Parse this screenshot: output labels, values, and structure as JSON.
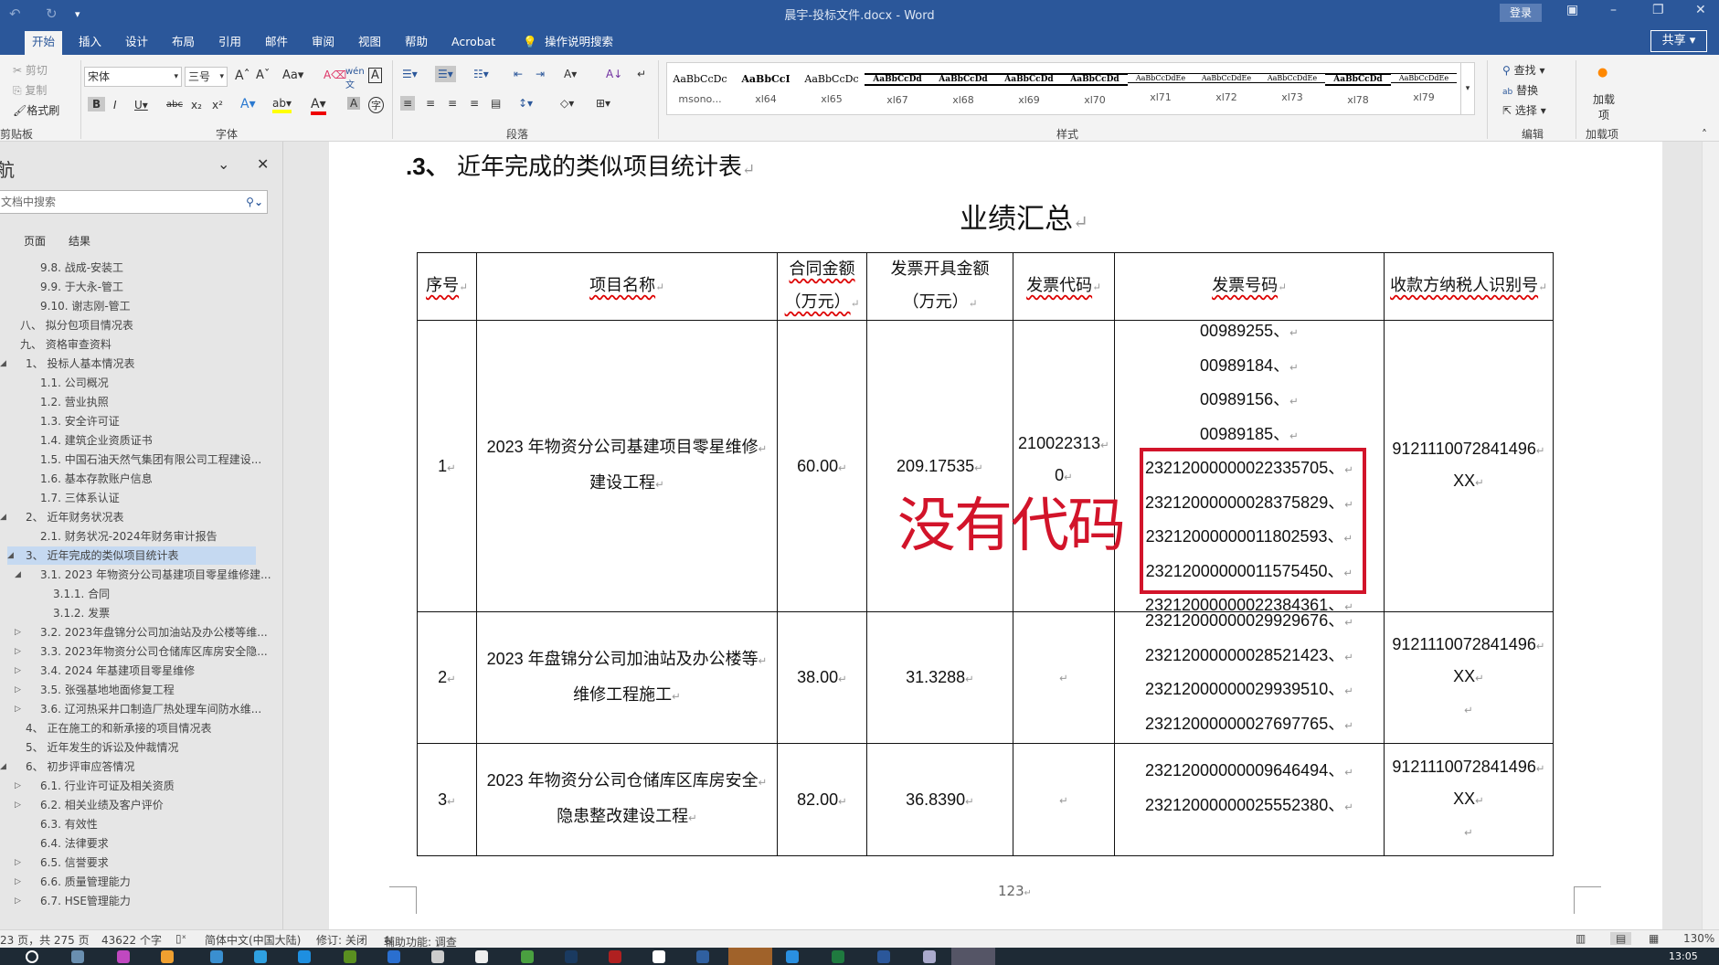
{
  "window": {
    "title": "晨宇-投标文件.docx - Word",
    "login": "登录",
    "share": "共享"
  },
  "tabs": [
    "开始",
    "插入",
    "设计",
    "布局",
    "引用",
    "邮件",
    "审阅",
    "视图",
    "帮助",
    "Acrobat",
    "操作说明搜索"
  ],
  "ribbon": {
    "clipboard": {
      "cut": "剪切",
      "copy": "复制",
      "format_painter": "格式刷",
      "label": "剪贴板"
    },
    "font": {
      "name": "宋体",
      "size": "三号",
      "label": "字体"
    },
    "paragraph": {
      "label": "段落"
    },
    "styles": {
      "label": "样式",
      "items": [
        "msono...",
        "xl64",
        "xl65",
        "xl67",
        "xl68",
        "xl69",
        "xl70",
        "xl71",
        "xl72",
        "xl73",
        "xl78",
        "xl79"
      ],
      "preview": [
        "AaBbCcDc",
        "AaBbCcI",
        "AaBbCcDc",
        "AaBbCcDd",
        "AaBbCcDd",
        "AaBbCcDd",
        "AaBbCcDd",
        "AaBbCcDdEe",
        "AaBbCcDdEe",
        "AaBbCcDdEe",
        "AaBbCcDd",
        "AaBbCcDdEe"
      ]
    },
    "editing": {
      "find": "查找",
      "replace": "替换",
      "select": "选择",
      "label": "编辑"
    },
    "addins": {
      "button": "加载项",
      "label": "加载项"
    }
  },
  "nav": {
    "title": "航",
    "search_placeholder": "文档中搜索",
    "tabs": [
      "页面",
      "结果"
    ],
    "items": [
      {
        "label": "9.8. 战成-安装工",
        "level": 2,
        "toggle": ""
      },
      {
        "label": "9.9. 于大永-管工",
        "level": 2,
        "toggle": ""
      },
      {
        "label": "9.10. 谢志刚-管工",
        "level": 2,
        "toggle": ""
      },
      {
        "label": "八、 拟分包项目情况表",
        "level": 0,
        "toggle": ""
      },
      {
        "label": "九、 资格审查资料",
        "level": 0,
        "toggle": ""
      },
      {
        "label": "1、 投标人基本情况表",
        "level": 1,
        "toggle": "◢"
      },
      {
        "label": "1.1. 公司概况",
        "level": 2,
        "toggle": ""
      },
      {
        "label": "1.2. 营业执照",
        "level": 2,
        "toggle": ""
      },
      {
        "label": "1.3. 安全许可证",
        "level": 2,
        "toggle": ""
      },
      {
        "label": "1.4. 建筑企业资质证书",
        "level": 2,
        "toggle": ""
      },
      {
        "label": "1.5. 中国石油天然气集团有限公司工程建设...",
        "level": 2,
        "toggle": ""
      },
      {
        "label": "1.6. 基本存款账户信息",
        "level": 2,
        "toggle": ""
      },
      {
        "label": "1.7. 三体系认证",
        "level": 2,
        "toggle": ""
      },
      {
        "label": "2、 近年财务状况表",
        "level": 1,
        "toggle": "◢"
      },
      {
        "label": "2.1. 财务状况-2024年财务审计报告",
        "level": 2,
        "toggle": ""
      },
      {
        "label": "3、 近年完成的类似项目统计表",
        "level": 1,
        "toggle": "◢",
        "selected": true
      },
      {
        "label": "3.1. 2023 年物资分公司基建项目零星维修建...",
        "level": 2,
        "toggle": "◢"
      },
      {
        "label": "3.1.1. 合同",
        "level": 3,
        "toggle": ""
      },
      {
        "label": "3.1.2. 发票",
        "level": 3,
        "toggle": ""
      },
      {
        "label": "3.2. 2023年盘锦分公司加油站及办公楼等维...",
        "level": 2,
        "toggle": "▷"
      },
      {
        "label": "3.3. 2023年物资分公司仓储库区库房安全隐...",
        "level": 2,
        "toggle": "▷"
      },
      {
        "label": "3.4. 2024 年基建项目零星维修",
        "level": 2,
        "toggle": "▷"
      },
      {
        "label": "3.5. 张强基地地面修复工程",
        "level": 2,
        "toggle": "▷"
      },
      {
        "label": "3.6. 辽河热采井口制造厂热处理车间防水维...",
        "level": 2,
        "toggle": "▷"
      },
      {
        "label": "4、 正在施工的和新承接的项目情况表",
        "level": 1,
        "toggle": ""
      },
      {
        "label": "5、 近年发生的诉讼及仲裁情况",
        "level": 1,
        "toggle": ""
      },
      {
        "label": "6、 初步评审应答情况",
        "level": 1,
        "toggle": "◢"
      },
      {
        "label": "6.1. 行业许可证及相关资质",
        "level": 2,
        "toggle": "▷"
      },
      {
        "label": "6.2. 相关业绩及客户评价",
        "level": 2,
        "toggle": "▷"
      },
      {
        "label": "6.3. 有效性",
        "level": 2,
        "toggle": ""
      },
      {
        "label": "6.4. 法律要求",
        "level": 2,
        "toggle": ""
      },
      {
        "label": "6.5. 信誉要求",
        "level": 2,
        "toggle": "▷"
      },
      {
        "label": "6.6. 质量管理能力",
        "level": 2,
        "toggle": "▷"
      },
      {
        "label": "6.7. HSE管理能力",
        "level": 2,
        "toggle": "▷"
      }
    ]
  },
  "document": {
    "heading_num": ".3、",
    "heading": "近年完成的类似项目统计表",
    "subtitle": "业绩汇总",
    "table": {
      "headers": [
        "序号",
        "项目名称",
        "合同金额",
        "（万元）",
        "发票开具金额",
        "（万元）",
        "发票代码",
        "发票号码",
        "收款方纳税人识别号"
      ],
      "rows": [
        {
          "no": "1",
          "name": [
            "2023 年物资分公司基建项目零星维修",
            "建设工程"
          ],
          "contract": "60.00",
          "invoiced": "209.17535",
          "code": [
            "210022313",
            "0"
          ],
          "numbers": [
            "00989255、",
            "00989184、",
            "00989156、",
            "00989185、",
            "23212000000022335705、",
            "23212000000028375829、",
            "23212000000011802593、",
            "23212000000011575450、",
            "23212000000022384361、"
          ],
          "taxid": [
            "9121110072841496",
            "XX"
          ]
        },
        {
          "no": "2",
          "name": [
            "2023 年盘锦分公司加油站及办公楼等",
            "维修工程施工"
          ],
          "contract": "38.00",
          "invoiced": "31.3288",
          "code": [
            ""
          ],
          "numbers": [
            "23212000000029929676、",
            "23212000000028521423、",
            "23212000000029939510、",
            "23212000000027697765、"
          ],
          "taxid": [
            "9121110072841496",
            "XX"
          ]
        },
        {
          "no": "3",
          "name": [
            "2023 年物资分公司仓储库区库房安全",
            "隐患整改建设工程"
          ],
          "contract": "82.00",
          "invoiced": "36.8390",
          "code": [
            ""
          ],
          "numbers": [
            "23212000000009646494、",
            "23212000000025552380、"
          ],
          "taxid": [
            "9121110072841496",
            "XX"
          ]
        }
      ]
    },
    "annotation": "没有代码",
    "annotation_color": "#d2142a",
    "page_number": "123"
  },
  "status": {
    "page": "23 页，共 275 页",
    "words": "43622 个字",
    "language": "简体中文(中国大陆)",
    "track": "修订: 关闭",
    "accessibility": "辅助功能: 调查",
    "zoom": "130%"
  },
  "taskbar": {
    "time": "13:05"
  }
}
